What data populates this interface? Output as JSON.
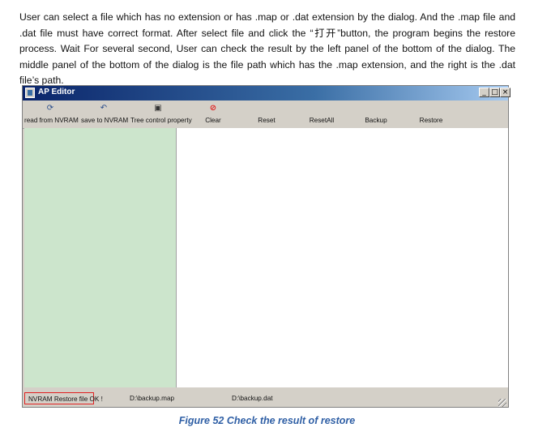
{
  "paragraph": "User can select a file which has no extension or has .map or .dat extension by the dialog. And the .map file and .dat file must have correct format. After select file and click the “打开”button, the program begins the restore process. Wait For several second, User can check the result by the left panel of the bottom of the dialog. The middle panel of the bottom of the dialog is the file path which has the .map extension, and the right is the .dat file’s path.",
  "window": {
    "title": "AP Editor",
    "controls": {
      "minimize": "_",
      "maximize": "□",
      "close": "×"
    }
  },
  "toolbar": {
    "read": {
      "icon": "refresh-icon",
      "label": "read from NVRAM"
    },
    "save": {
      "icon": "undo-icon",
      "label": "save to NVRAM"
    },
    "tree": {
      "icon": "properties-icon",
      "label": "Tree control property"
    },
    "clear": {
      "icon": "clear-icon",
      "label": "Clear"
    },
    "reset": {
      "label": "Reset"
    },
    "reset_all": {
      "label": "ResetAll"
    },
    "backup": {
      "label": "Backup"
    },
    "restore": {
      "label": "Restore"
    }
  },
  "status": {
    "result": "NVRAM Restore file OK !",
    "map_path": "D:\\backup.map",
    "dat_path": "D:\\backup.dat"
  },
  "colors": {
    "left_panel": "#cce5cc",
    "clear_icon": "#e02020",
    "caption": "#2f5fa5",
    "status_highlight": "#e02020"
  },
  "caption": "Figure 52 Check the result of restore"
}
